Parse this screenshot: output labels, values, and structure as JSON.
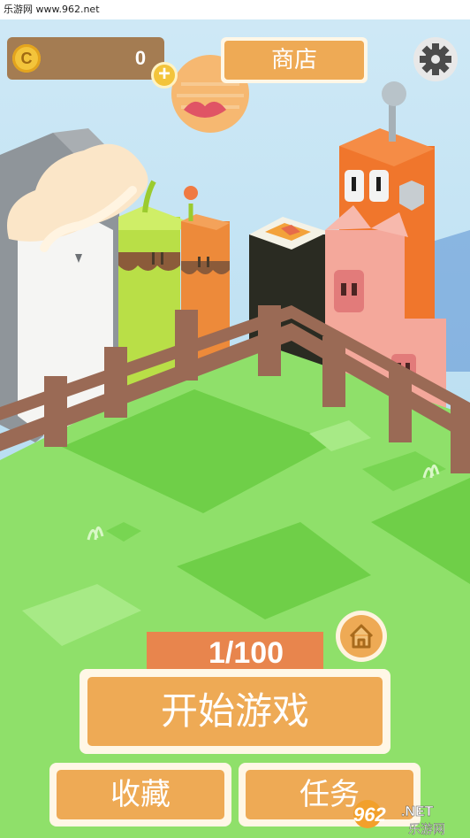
{
  "watermark": {
    "text": "乐游网 www.962.net"
  },
  "top_bar": {
    "coin_symbol": "C",
    "coin_count": "0",
    "plus_label": "+",
    "shop_label": "商店"
  },
  "progress": {
    "text": "1/100",
    "current": 1,
    "total": 100
  },
  "buttons": {
    "start": "开始游戏",
    "collection": "收藏",
    "tasks": "任务"
  },
  "logo": {
    "main_text": "962",
    "suffix_text": ".NET",
    "sub_text": "乐游网"
  },
  "icons": {
    "gear": "gear-icon",
    "home": "home-icon",
    "coin": "coin-icon",
    "plus": "plus-icon"
  },
  "colors": {
    "button_orange": "#eeaa55",
    "counter_orange": "#e8854d",
    "coin_bar": "#a47c52",
    "grass": "#8fe06a",
    "sky": "#bfe2f2"
  }
}
